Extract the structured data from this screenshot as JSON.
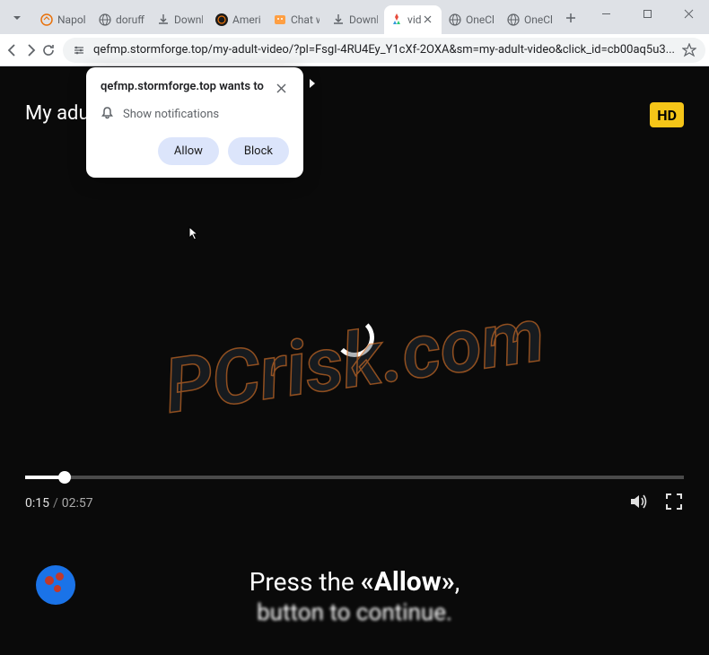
{
  "window": {
    "tabs": [
      {
        "title": "Napole"
      },
      {
        "title": "doruffl"
      },
      {
        "title": "Downl"
      },
      {
        "title": "Americ"
      },
      {
        "title": "Chat w"
      },
      {
        "title": "Downl"
      },
      {
        "title": "vid"
      },
      {
        "title": "OneCli"
      },
      {
        "title": "OneCl"
      }
    ]
  },
  "toolbar": {
    "url": "qefmp.stormforge.top/my-adult-video/?pl=FsgI-4RU4Ey_Y1cXf-2OXA&sm=my-adult-video&click_id=cb00aq5u3..."
  },
  "notification": {
    "title": "qefmp.stormforge.top wants to",
    "body": "Show notifications",
    "allow": "Allow",
    "block": "Block"
  },
  "page": {
    "title": "My adul",
    "hd": "HD",
    "time_current": "0:15",
    "time_sep": "/",
    "time_duration": "02:57",
    "press_pre": "Press the ",
    "press_word": "«Allow»",
    "press_comma": ",",
    "press_line2": "button to continue."
  },
  "watermark": "PCrisk.com"
}
